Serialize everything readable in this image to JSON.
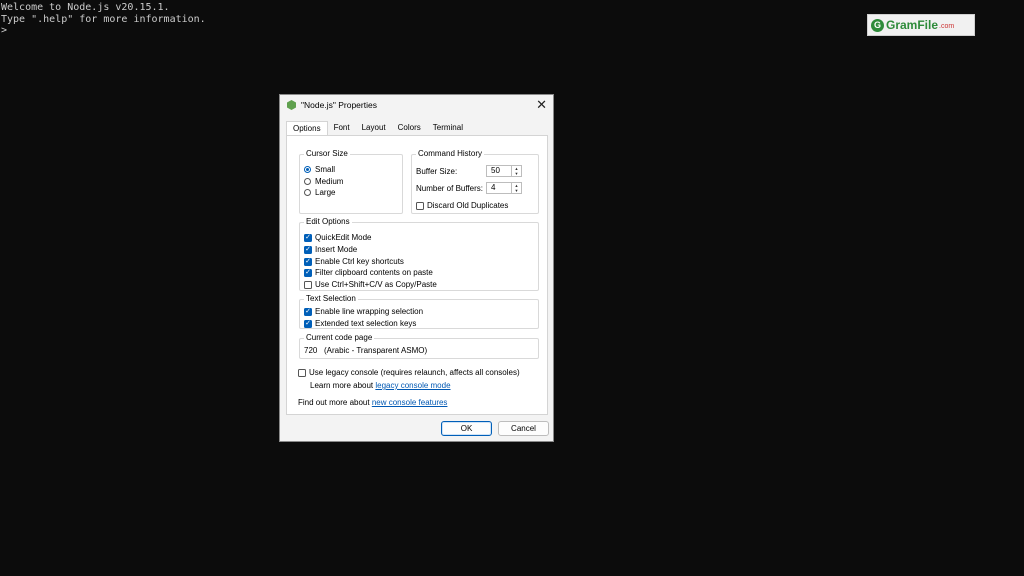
{
  "console": {
    "line1": "Welcome to Node.js v20.15.1.",
    "line2": "Type \".help\" for more information.",
    "prompt": ">"
  },
  "watermark": {
    "name": "GramFile",
    "suffix": ".com"
  },
  "dialog": {
    "title": "\"Node.js\" Properties",
    "close_label": "✕",
    "tabs": [
      {
        "label": "Options",
        "active": true
      },
      {
        "label": "Font"
      },
      {
        "label": "Layout"
      },
      {
        "label": "Colors"
      },
      {
        "label": "Terminal"
      }
    ],
    "cursor_size": {
      "title": "Cursor Size",
      "options": [
        {
          "label": "Small",
          "selected": true
        },
        {
          "label": "Medium",
          "selected": false
        },
        {
          "label": "Large",
          "selected": false
        }
      ]
    },
    "command_history": {
      "title": "Command History",
      "buffer_size_label": "Buffer Size:",
      "buffer_size_value": "50",
      "num_buffers_label": "Number of Buffers:",
      "num_buffers_value": "4",
      "discard_label": "Discard Old Duplicates",
      "discard_checked": false
    },
    "edit_options": {
      "title": "Edit Options",
      "items": [
        {
          "label": "QuickEdit Mode",
          "checked": true
        },
        {
          "label": "Insert Mode",
          "checked": true
        },
        {
          "label": "Enable Ctrl key shortcuts",
          "checked": true
        },
        {
          "label": "Filter clipboard contents on paste",
          "checked": true
        },
        {
          "label": "Use Ctrl+Shift+C/V as Copy/Paste",
          "checked": false
        }
      ]
    },
    "text_selection": {
      "title": "Text Selection",
      "items": [
        {
          "label": "Enable line wrapping selection",
          "checked": true
        },
        {
          "label": "Extended text selection keys",
          "checked": true
        }
      ]
    },
    "code_page": {
      "title": "Current code page",
      "value": "720   (Arabic - Transparent ASMO)"
    },
    "legacy": {
      "label": "Use legacy console (requires relaunch, affects all consoles)",
      "checked": false,
      "learn_prefix": "Learn more about ",
      "learn_link": "legacy console mode"
    },
    "find_out": {
      "prefix": "Find out more about ",
      "link": "new console features"
    },
    "ok_label": "OK",
    "cancel_label": "Cancel"
  }
}
